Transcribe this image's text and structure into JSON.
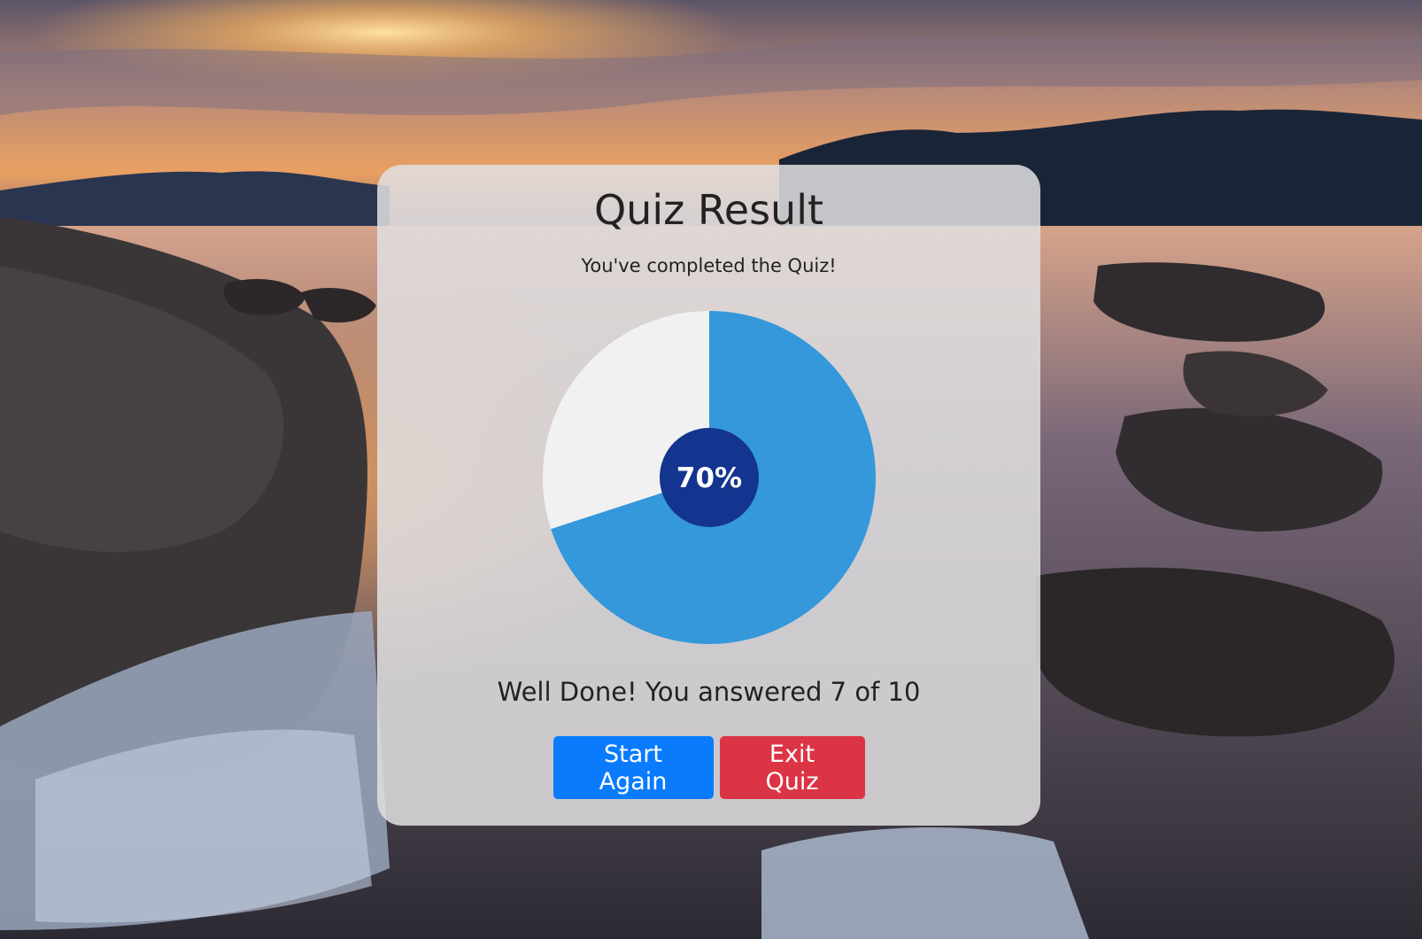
{
  "result": {
    "title": "Quiz Result",
    "subtitle": "You've completed the Quiz!",
    "message": "Well Done! You answered 7 of 10",
    "percent_label": "70%"
  },
  "actions": {
    "start_again_label": "Start Again",
    "exit_label": "Exit Quiz"
  },
  "chart_data": {
    "type": "pie",
    "slices": [
      {
        "value": 70,
        "color": "#3498db"
      },
      {
        "value": 30,
        "color": "#f1f1f1"
      }
    ],
    "center_label": "70%",
    "center_color": "#14358f"
  },
  "colors": {
    "primary_button": "#0a7bfd",
    "danger_button": "#db3545"
  }
}
